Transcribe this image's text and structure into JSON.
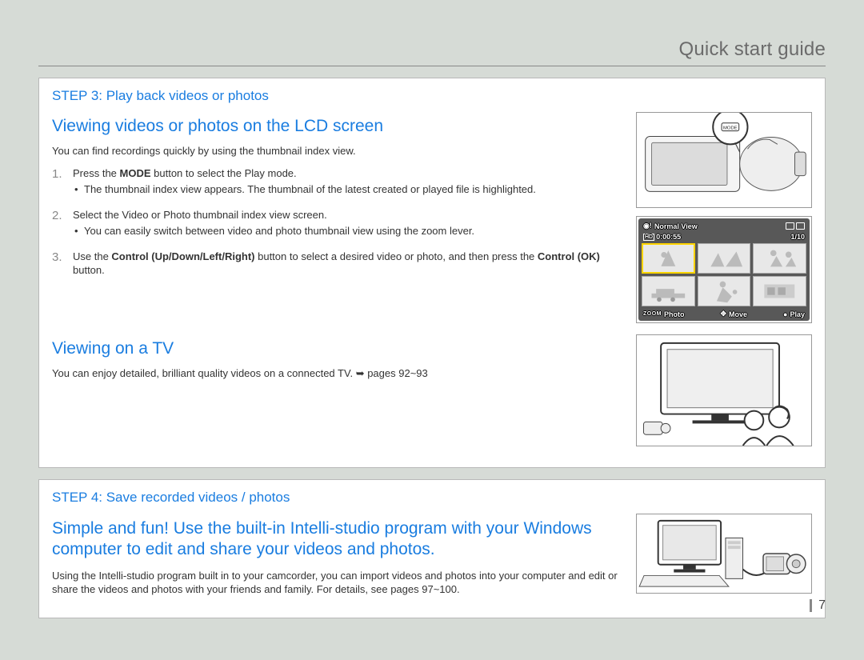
{
  "header": {
    "title": "Quick start guide"
  },
  "page_number": "7",
  "step3": {
    "title": "STEP 3: Play back videos or photos",
    "section1": {
      "heading": "Viewing videos or photos on the LCD screen",
      "intro": "You can find recordings quickly by using the thumbnail index view.",
      "items": [
        {
          "pre": "Press the ",
          "bold": "MODE",
          "post": " button to select the Play mode.",
          "bullets": [
            "The thumbnail index view appears. The thumbnail of the latest created or played file is highlighted."
          ]
        },
        {
          "text": "Select the Video or Photo thumbnail index view screen.",
          "bullets": [
            "You can easily switch between video and photo thumbnail view using the zoom lever."
          ]
        },
        {
          "pre": "Use the ",
          "bold": "Control (Up/Down/Left/Right)",
          "post": " button to select a desired video or photo, and then press the ",
          "bold2": "Control (OK)",
          "post2": " button."
        }
      ]
    },
    "section2": {
      "heading": "Viewing on a TV",
      "text_pre": "You can enjoy detailed, brilliant quality videos on a connected TV. ",
      "text_post": " pages 92~93"
    },
    "screen": {
      "top_label": "Normal View",
      "time": "0:00:55",
      "counter": "1/10",
      "bot_zoom": "ZOOM",
      "bot_left": "Photo",
      "bot_mid": "Move",
      "bot_right": "Play"
    },
    "mode_label": "MODE"
  },
  "step4": {
    "title": "STEP 4: Save recorded videos / photos",
    "heading": "Simple and fun! Use the built-in Intelli-studio program with your Windows computer to edit and share your videos and photos.",
    "body": "Using the Intelli-studio program built in to your camcorder, you can import videos and photos into your computer and edit or share the videos and photos with your friends and family. For details, see pages 97~100."
  }
}
